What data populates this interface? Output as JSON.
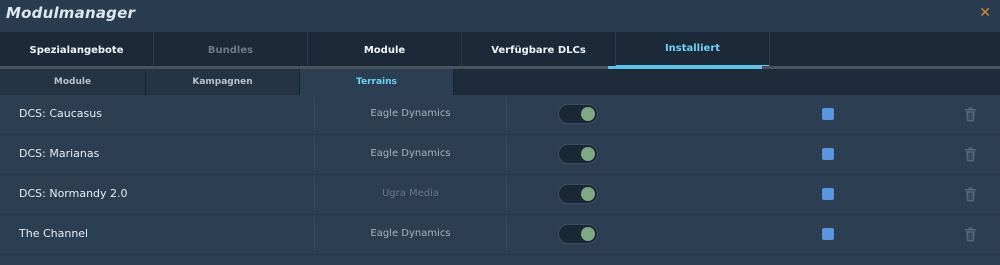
{
  "window": {
    "title": "Modulmanager",
    "close_icon": "close-icon"
  },
  "main_tabs": [
    {
      "label": "Spezialangebote",
      "state": "normal"
    },
    {
      "label": "Bundles",
      "state": "disabled"
    },
    {
      "label": "Module",
      "state": "normal"
    },
    {
      "label": "Verfügbare DLCs",
      "state": "normal"
    },
    {
      "label": "Installiert",
      "state": "active"
    }
  ],
  "sub_tabs": [
    {
      "label": "Module",
      "state": "normal"
    },
    {
      "label": "Kampagnen",
      "state": "normal"
    },
    {
      "label": "Terrains",
      "state": "active"
    }
  ],
  "rows": [
    {
      "name": "DCS: Caucasus",
      "vendor": "Eagle Dynamics",
      "enabled": true,
      "checked": true
    },
    {
      "name": "DCS: Marianas",
      "vendor": "Eagle Dynamics",
      "enabled": true,
      "checked": true
    },
    {
      "name": "DCS: Normandy 2.0",
      "vendor": "Ugra Media",
      "enabled": true,
      "checked": true
    },
    {
      "name": "The Channel",
      "vendor": "Eagle Dynamics",
      "enabled": true,
      "checked": true
    }
  ],
  "colors": {
    "accent": "#5ec3e4",
    "toggle_knob": "#7fa885",
    "checkbox": "#5a95de",
    "close": "#d98a3a"
  }
}
